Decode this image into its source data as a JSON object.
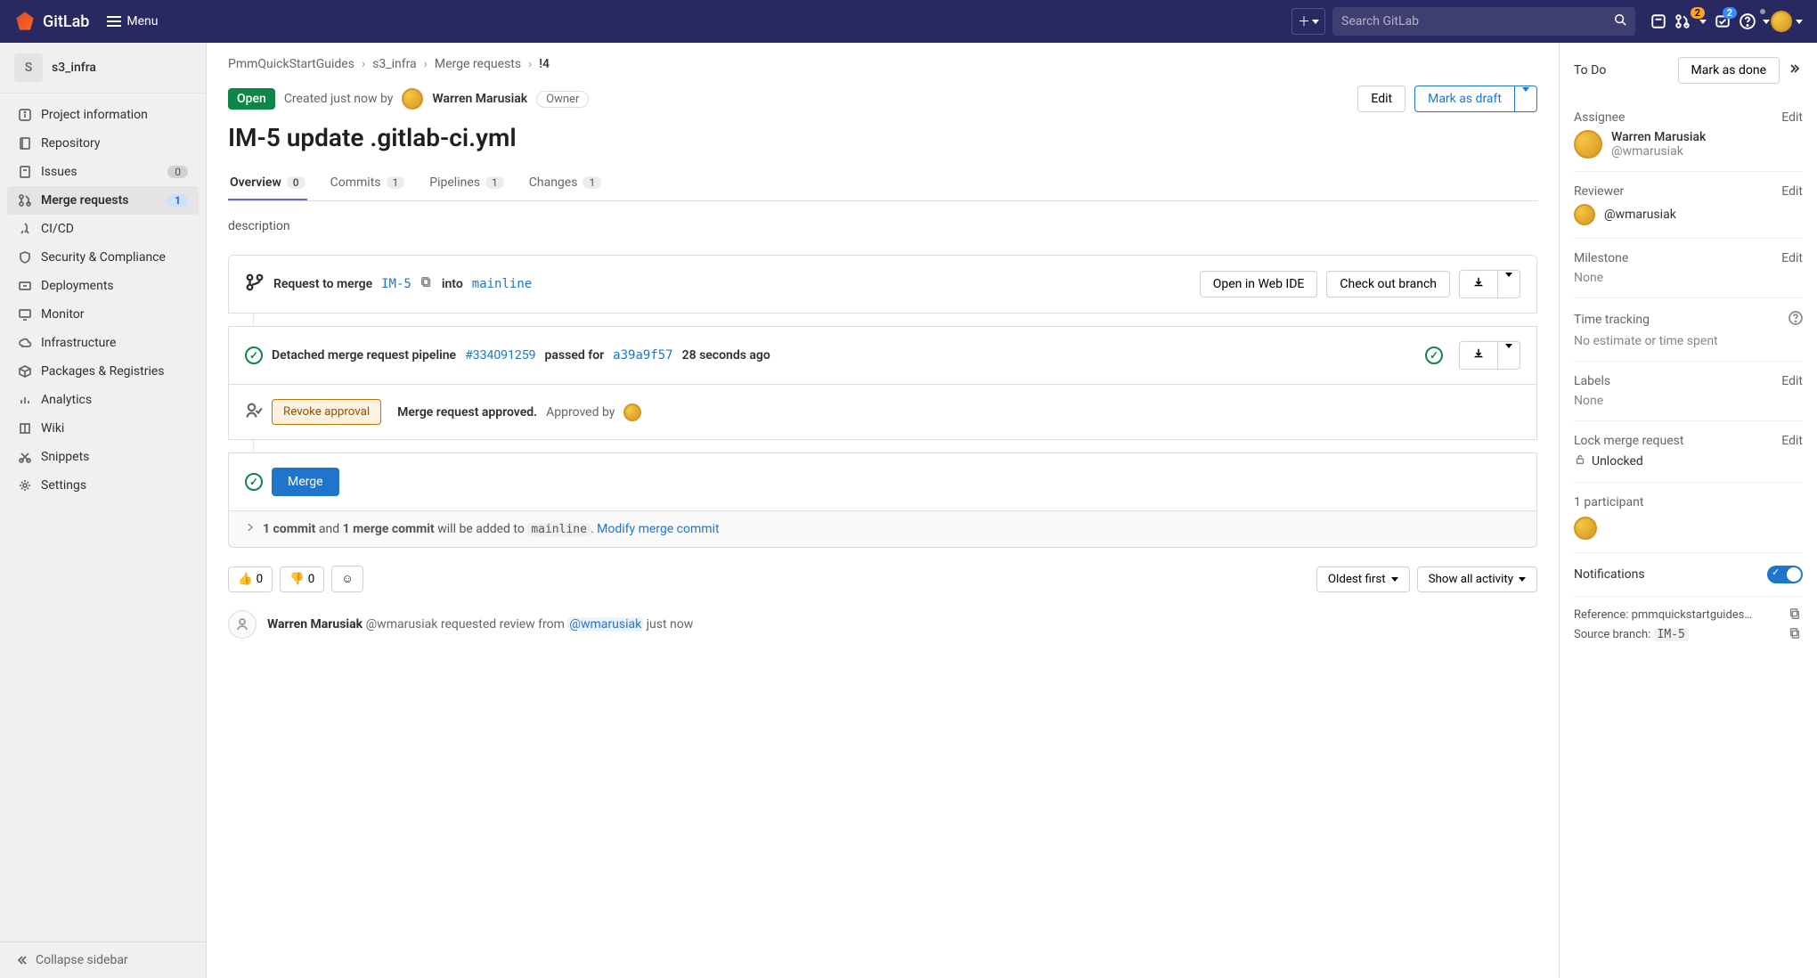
{
  "header": {
    "brand": "GitLab",
    "menu": "Menu",
    "search_placeholder": "Search GitLab",
    "mr_count": "2",
    "todo_count": "2"
  },
  "project": {
    "avatar_letter": "S",
    "name": "s3_infra"
  },
  "sidebar": {
    "items": [
      {
        "label": "Project information"
      },
      {
        "label": "Repository"
      },
      {
        "label": "Issues",
        "badge": "0"
      },
      {
        "label": "Merge requests",
        "badge": "1",
        "active": true
      },
      {
        "label": "CI/CD"
      },
      {
        "label": "Security & Compliance"
      },
      {
        "label": "Deployments"
      },
      {
        "label": "Monitor"
      },
      {
        "label": "Infrastructure"
      },
      {
        "label": "Packages & Registries"
      },
      {
        "label": "Analytics"
      },
      {
        "label": "Wiki"
      },
      {
        "label": "Snippets"
      },
      {
        "label": "Settings"
      }
    ],
    "collapse": "Collapse sidebar"
  },
  "breadcrumbs": {
    "group": "PmmQuickStartGuides",
    "project": "s3_infra",
    "section": "Merge requests",
    "mr_ref": "!4"
  },
  "mr": {
    "status": "Open",
    "created_prefix": "Created just now by",
    "author": "Warren Marusiak",
    "role": "Owner",
    "edit": "Edit",
    "mark_draft": "Mark as draft",
    "title": "IM-5 update .gitlab-ci.yml"
  },
  "tabs": {
    "overview": {
      "label": "Overview",
      "count": "0"
    },
    "commits": {
      "label": "Commits",
      "count": "1"
    },
    "pipelines": {
      "label": "Pipelines",
      "count": "1"
    },
    "changes": {
      "label": "Changes",
      "count": "1"
    }
  },
  "body": {
    "desc": "description",
    "request_to_merge": "Request to merge",
    "source_branch": "IM-5",
    "into": "into",
    "target_branch": "mainline",
    "open_ide": "Open in Web IDE",
    "check_out": "Check out branch",
    "pipeline_pre": "Detached merge request pipeline",
    "pipeline_id": "#334091259",
    "pipeline_mid": "passed for",
    "pipeline_sha": "a39a9f57",
    "pipeline_time": "28 seconds ago",
    "revoke": "Revoke approval",
    "approved_strong": "Merge request approved.",
    "approved_by": "Approved by",
    "merge": "Merge",
    "commit_bold1": "1 commit",
    "commit_mid1": "and",
    "commit_bold2": "1 merge commit",
    "commit_mid2": "will be added to",
    "commit_branch": "mainline",
    "modify_link": "Modify merge commit"
  },
  "reactions": {
    "up": "0",
    "down": "0",
    "oldest": "Oldest first",
    "show_all": "Show all activity"
  },
  "activity": {
    "author": "Warren Marusiak",
    "author_handle": "@wmarusiak",
    "text_mid": "requested review from",
    "reviewer_handle": "@wmarusiak",
    "time": "just now"
  },
  "right": {
    "todo": "To Do",
    "mark_done": "Mark as done",
    "assignee": "Assignee",
    "edit": "Edit",
    "assignee_name": "Warren Marusiak",
    "assignee_handle": "@wmarusiak",
    "reviewer": "Reviewer",
    "reviewer_handle": "@wmarusiak",
    "milestone": "Milestone",
    "none": "None",
    "time_tracking": "Time tracking",
    "time_none": "No estimate or time spent",
    "labels": "Labels",
    "lock": "Lock merge request",
    "unlocked": "Unlocked",
    "participants": "1 participant",
    "notifications": "Notifications",
    "reference_label": "Reference: ",
    "reference": "pmmquickstartguides…",
    "source_label": "Source branch: ",
    "source": "IM-5"
  }
}
